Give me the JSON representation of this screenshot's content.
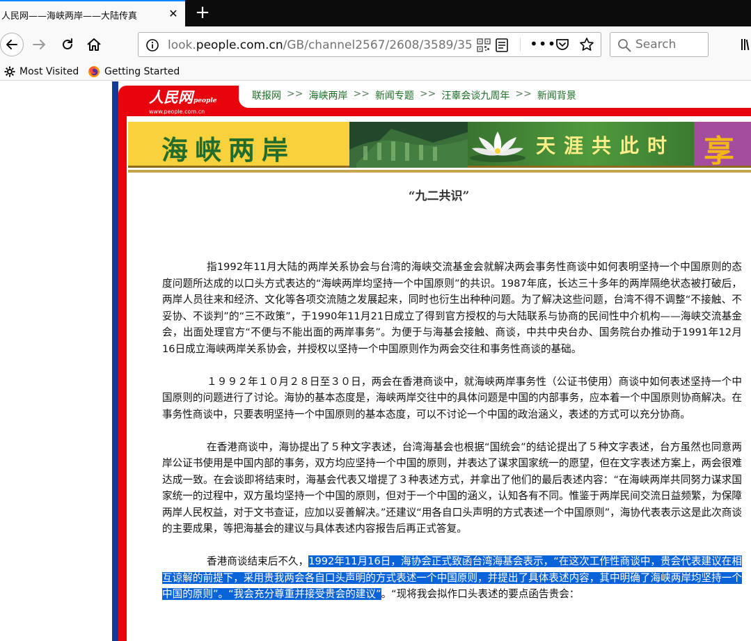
{
  "browser": {
    "tab": {
      "title": "人民网——海峡两岸——大陆传真",
      "close_label": "✕"
    },
    "new_tab_label": "+",
    "url": {
      "prefix": "look.",
      "domain": "people.com.cn",
      "path": "/GB/channel2567/2608/3589/359"
    },
    "search": {
      "placeholder": "Search"
    },
    "bookmarks": [
      {
        "label": "Most Visited",
        "icon": "gear-icon"
      },
      {
        "label": "Getting Started",
        "icon": "firefox-icon"
      }
    ]
  },
  "page": {
    "logo": {
      "main": "人民网",
      "sub": "people",
      "url": "www.people.com.cn"
    },
    "breadcrumb": [
      "联报网",
      "海峡两岸",
      "新闻专题",
      "汪辜会谈九周年",
      "新闻背景"
    ],
    "breadcrumb_sep": ">>",
    "banner": {
      "title": "海峡两岸",
      "slogan": "天涯共此时",
      "side_char": "享"
    },
    "article": {
      "title": "“九二共识”",
      "paragraphs": [
        "指1992年11月大陆的两岸关系协会与台湾的海峡交流基金会就解决两会事务性商谈中如何表明坚持一个中国原则的态度问题所达成的以口头方式表达的“海峡两岸均坚持一个中国原则”的共识。1987年底，长达三十多年的两岸隔绝状态被打破后，两岸人员往来和经济、文化等各项交流随之发展起来，同时也衍生出种种问题。为了解决这些问题，台湾不得不调整“不接触、不妥协、不谈判”的“三不政策”，于1990年11月21日成立了得到官方授权的与大陆联系与协商的民间性中介机构——海峡交流基金会，出面处理官方“不便与不能出面的两岸事务”。为便于与海基会接触、商谈，中共中央台办、国务院台办推动于1991年12月16日成立海峡两岸关系协会，并授权以坚持一个中国原则作为两会交往和事务性商谈的基础。",
        "１９９２年１０月２８日至３０日，两会在香港商谈中，就海峡两岸事务性（公证书使用）商谈中如何表述坚持一个中国原则的问题进行了讨论。海协的基本态度是，海峡两岸交往中的具体问题是中国的内部事务，应本着一个中国原则协商解决。在事务性商谈中，只要表明坚持一个中国原则的基本态度，可以不讨论一个中国的政治涵义，表述的方式可以充分协商。",
        "在香港商谈中，海协提出了５种文字表述，台湾海基会也根据“国统会”的结论提出了５种文字表述，台方虽然也同意两岸公证书使用是中国内部的事务，双方均应坚持一个中国的原则，并表达了谋求国家统一的愿望，但在文字表述方案上，两会很难达成一致。在会谈即将结束时，海基会代表又增提了３种表述方式，并拿出了他们的最后表述内容：“在海峡两岸共同努力谋求国家统一的过程中，双方虽均坚持一个中国的原则，但对于一个中国的涵义，认知各有不同。惟鉴于两岸民间交流日益频繁，为保障两岸人民权益，对于文书查证，应加以妥善解决。”还建议“用各自口头声明的方式表述一个中国原则”，海协代表表示这是此次商谈的主要成果，等把海基会的建议与具体表述内容报告后再正式答复。"
      ],
      "last_paragraph": {
        "before": "香港商谈结束后不久，",
        "highlighted": "1992年11月16日，海协会正式致函台湾海基会表示，“在这次工作性商谈中，贵会代表建议在相互谅解的前提下，采用贵我两会各自口头声明的方式表述一个中国原则，并提出了具体表述内容，其中明确了海峡两岸均坚持一个中国的原则”。“我会充分尊重并接受贵会的建议”",
        "after": "。“现将我会拟作口头表述的要点函告贵会："
      }
    }
  }
}
